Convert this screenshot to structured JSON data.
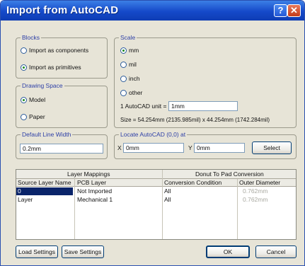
{
  "window": {
    "title": "Import from AutoCAD",
    "help_glyph": "?",
    "close_glyph": "✕"
  },
  "blocks": {
    "label": "Blocks",
    "options": [
      "Import as components",
      "Import as primitives"
    ],
    "selected": "Import as primitives"
  },
  "drawing_space": {
    "label": "Drawing Space",
    "options": [
      "Model",
      "Paper"
    ],
    "selected": "Model"
  },
  "scale": {
    "label": "Scale",
    "options": [
      "mm",
      "mil",
      "inch",
      "other"
    ],
    "selected": "mm",
    "unit_label": "1 AutoCAD unit =",
    "unit_value": "1mm",
    "size_text": "Size = 54.254mm (2135.985mil) x 44.254mm (1742.284mil)"
  },
  "default_line_width": {
    "label": "Default Line Width",
    "value": "0.2mm"
  },
  "locate": {
    "label": "Locate AutoCAD (0,0) at",
    "x_label": "X",
    "x_value": "0mm",
    "y_label": "Y",
    "y_value": "0mm",
    "select_label": "Select"
  },
  "grid": {
    "group_left": "Layer Mappings",
    "group_right": "Donut To Pad Conversion",
    "columns": [
      "Source Layer Name",
      "PCB Layer",
      "Conversion Condition",
      "Outer Diameter"
    ],
    "rows": [
      {
        "source": "0",
        "pcb": "Not Imported",
        "condition": "All",
        "diameter": "0.762mm"
      },
      {
        "source": "Layer",
        "pcb": "Mechanical 1",
        "condition": "All",
        "diameter": "0.762mm"
      }
    ]
  },
  "buttons": {
    "load": "Load Settings",
    "save": "Save Settings",
    "ok": "OK",
    "cancel": "Cancel"
  },
  "colors": {
    "title_bar": "#1549c9",
    "group_label": "#2c3ea6",
    "selected_row": "#0a246a",
    "radio_dot": "#1d8d1d"
  }
}
